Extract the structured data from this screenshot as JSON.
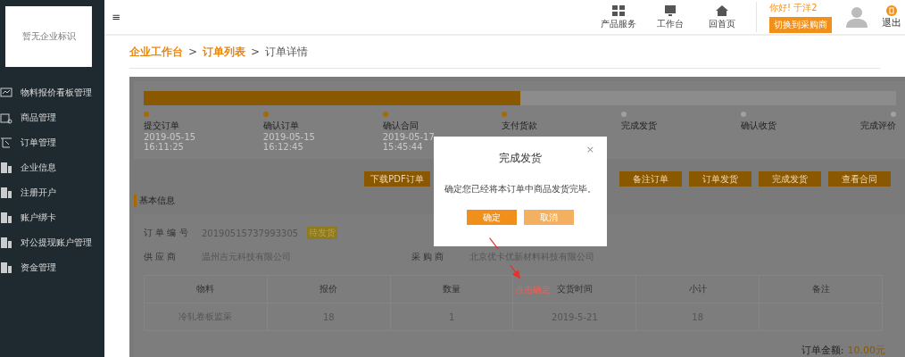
{
  "sidebar": {
    "logo_text": "暂无企业标识",
    "items": [
      {
        "label": "物料报价看板管理"
      },
      {
        "label": "商品管理"
      },
      {
        "label": "订单管理"
      },
      {
        "label": "企业信息"
      },
      {
        "label": "注册开户"
      },
      {
        "label": "账户绑卡"
      },
      {
        "label": "对公提现账户管理"
      },
      {
        "label": "资金管理"
      }
    ]
  },
  "header": {
    "menu_glyph": "≡",
    "shortcuts": [
      {
        "label": "产品服务"
      },
      {
        "label": "工作台"
      },
      {
        "label": "回首页"
      }
    ],
    "greeting": "你好! 于洋2",
    "switch_button": "切换到采购商",
    "logout": "退出"
  },
  "breadcrumb": [
    {
      "label": "企业工作台",
      "link": true
    },
    {
      "label": "订单列表",
      "link": true
    },
    {
      "label": "订单详情",
      "link": false
    }
  ],
  "breadcrumb_separator": ">",
  "progress": {
    "level": 0.5,
    "steps": [
      {
        "label": "提交订单",
        "done": true,
        "date": "2019-05-15",
        "time": "16:11:25"
      },
      {
        "label": "确认订单",
        "done": true,
        "date": "2019-05-15",
        "time": "16:12:45"
      },
      {
        "label": "确认合同",
        "done": true,
        "date": "2019-05-17",
        "time": "15:45:44"
      },
      {
        "label": "支付货款",
        "done": true
      },
      {
        "label": "完成发货",
        "done": false
      },
      {
        "label": "确认收货",
        "done": false
      },
      {
        "label": "完成评价",
        "done": false
      }
    ]
  },
  "actions": [
    "下载PDF订单",
    "备注订单",
    "订单发货",
    "完成发货",
    "查看合同"
  ],
  "section_title": "基本信息",
  "info": {
    "order_no_label": "订 单 编 号",
    "order_no": "20190515737993305",
    "status_badge": "待发货",
    "supplier_label": "供 应 商",
    "supplier": "温州吉元科技有限公司",
    "buyer_label": "采 购 商",
    "buyer": "北京优卡优新材料科技有限公司"
  },
  "table": {
    "columns": [
      "物料",
      "报价",
      "数量",
      "交货时间",
      "小计",
      "备注"
    ],
    "rows": [
      [
        "冷轧卷板监采",
        "18",
        "1",
        "2019-5-21",
        "18",
        ""
      ]
    ]
  },
  "total": {
    "label": "订单金额:",
    "value": "10.00元"
  },
  "dialog": {
    "title": "完成发货",
    "close": "×",
    "message": "确定您已经将本订单中商品发货完毕。",
    "confirm": "确定",
    "cancel": "取消"
  },
  "annotation": {
    "text": "点击确定"
  }
}
